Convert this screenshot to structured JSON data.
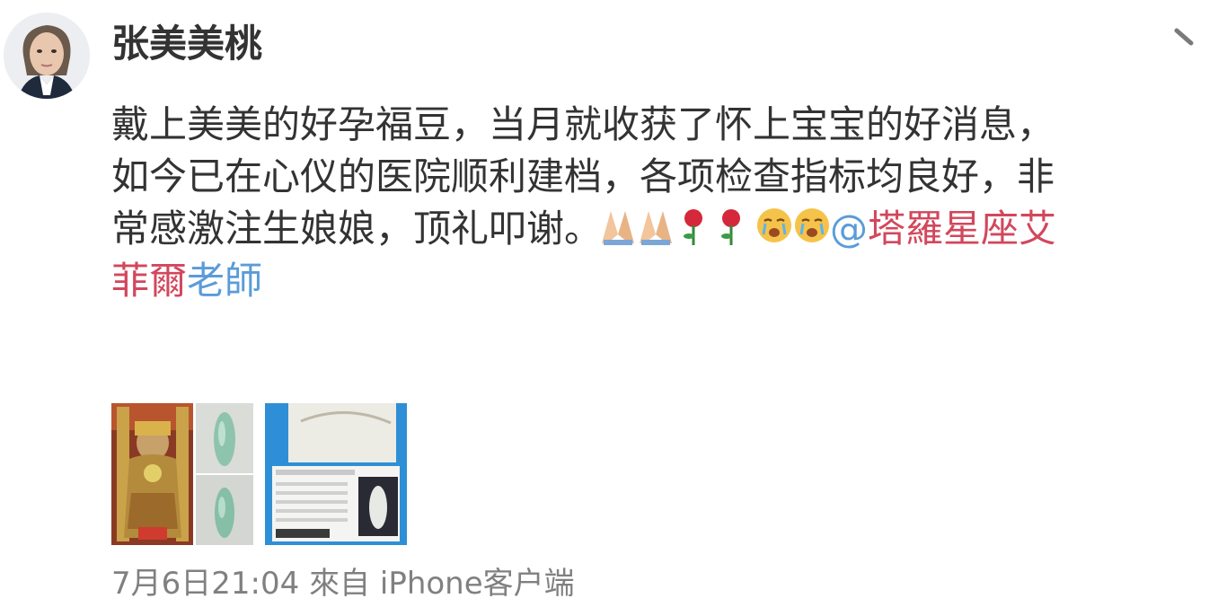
{
  "author": {
    "name": "张美美桃"
  },
  "post": {
    "lines": [
      "戴上美美的好孕福豆，当月就收获了怀上宝宝的好消息，",
      "如今已在心仪的医院顺利建档，各项检查指标均良好，非",
      "常感激注生娘娘，顶礼叩谢。"
    ],
    "emojis": [
      "praying-hands",
      "praying-hands",
      "rose",
      "rose",
      "crying-face",
      "crying-face"
    ],
    "mention": {
      "at": "@",
      "part_red_1": "塔羅星座艾",
      "part_red_2": "菲爾",
      "part_blue": "老師"
    }
  },
  "meta": {
    "time": "7月6日21:04",
    "source": "來自 iPhone客户端"
  },
  "colors": {
    "text": "#333333",
    "mention_red": "#d2475c",
    "mention_blue": "#5a9cd8",
    "meta": "#808080"
  }
}
